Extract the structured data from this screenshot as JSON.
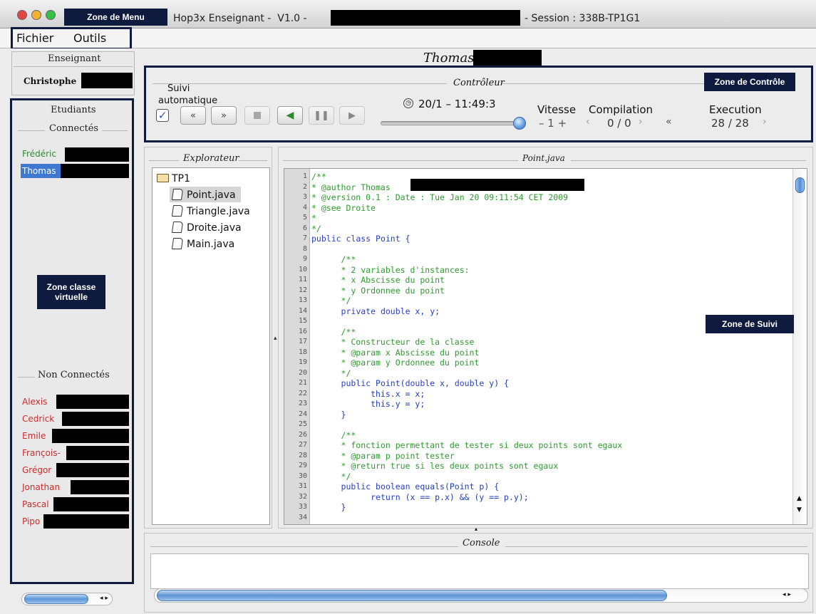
{
  "window": {
    "title_app": "Hop3x Enseignant -  V1.0 -",
    "title_session": "- Session : 338B-TP1G1"
  },
  "annotations": {
    "menu_zone": "Zone de Menu",
    "control_zone": "Zone de Contrôle",
    "class_zone_line1": "Zone classe",
    "class_zone_line2": "virtuelle",
    "tracking_zone": "Zone de Suivi"
  },
  "menu": {
    "items": [
      "Fichier",
      "Outils"
    ]
  },
  "teacher": {
    "group_title": "Enseignant",
    "name": "Christophe"
  },
  "students": {
    "group_title": "Etudiants",
    "connected_title": "Connectés",
    "connected": [
      "Frédéric",
      "Thomas"
    ],
    "disconnected_title": "Non Connectés",
    "disconnected": [
      "Alexis",
      "Cedrick",
      "Emile",
      "François-",
      "Grégor",
      "Jonathan",
      "Pascal",
      "Pipo"
    ]
  },
  "selected_student": "Thomas",
  "controller": {
    "title": "Contrôleur",
    "auto_follow_label_1": "Suivi",
    "auto_follow_label_2": "automatique",
    "auto_follow_checked": true,
    "timestamp": "20/1 – 11:49:3",
    "speed_label": "Vitesse",
    "speed_value": "– 1 +",
    "compilation_label": "Compilation",
    "compilation_value": "0 / 0",
    "execution_label": "Execution",
    "execution_value": "28 / 28",
    "slider_position": 0.97
  },
  "explorer": {
    "title": "Explorateur",
    "folder": "TP1",
    "files": [
      "Point.java",
      "Triangle.java",
      "Droite.java",
      "Main.java"
    ],
    "selected_file": "Point.java"
  },
  "editor": {
    "title": "Point.java",
    "lines": [
      {
        "n": "1",
        "t": "/**",
        "c": "comment"
      },
      {
        "n": "2",
        "t": "* @author Thomas",
        "c": "comment"
      },
      {
        "n": "3",
        "t": "* @version 0.1 : Date : Tue Jan 20 09:11:54 CET 2009",
        "c": "comment"
      },
      {
        "n": "4",
        "t": "* @see Droite",
        "c": "comment"
      },
      {
        "n": "5",
        "t": "*",
        "c": "comment"
      },
      {
        "n": "6",
        "t": "*/",
        "c": "comment"
      },
      {
        "n": "7",
        "t": "public class Point {",
        "c": "code"
      },
      {
        "n": "8",
        "t": "",
        "c": "code"
      },
      {
        "n": "9",
        "t": "      /**",
        "c": "comment"
      },
      {
        "n": "10",
        "t": "      * 2 variables d'instances:",
        "c": "comment"
      },
      {
        "n": "11",
        "t": "      * x Abscisse du point",
        "c": "comment"
      },
      {
        "n": "12",
        "t": "      * y Ordonnee du point",
        "c": "comment"
      },
      {
        "n": "13",
        "t": "      */",
        "c": "comment"
      },
      {
        "n": "14",
        "t": "      private double x, y;",
        "c": "code"
      },
      {
        "n": "15",
        "t": "",
        "c": "code"
      },
      {
        "n": "16",
        "t": "      /**",
        "c": "comment"
      },
      {
        "n": "17",
        "t": "      * Constructeur de la classe",
        "c": "comment"
      },
      {
        "n": "18",
        "t": "      * @param x Abscisse du point",
        "c": "comment"
      },
      {
        "n": "19",
        "t": "      * @param y Ordonnee du point",
        "c": "comment"
      },
      {
        "n": "20",
        "t": "      */",
        "c": "comment"
      },
      {
        "n": "21",
        "t": "      public Point(double x, double y) {",
        "c": "code"
      },
      {
        "n": "22",
        "t": "            this.x = x;",
        "c": "code"
      },
      {
        "n": "23",
        "t": "            this.y = y;",
        "c": "code"
      },
      {
        "n": "24",
        "t": "      }",
        "c": "code"
      },
      {
        "n": "25",
        "t": "",
        "c": "code"
      },
      {
        "n": "26",
        "t": "      /**",
        "c": "comment"
      },
      {
        "n": "27",
        "t": "      * fonction permettant de tester si deux points sont egaux",
        "c": "comment"
      },
      {
        "n": "28",
        "t": "      * @param p point tester",
        "c": "comment"
      },
      {
        "n": "29",
        "t": "      * @return true si les deux points sont egaux",
        "c": "comment"
      },
      {
        "n": "30",
        "t": "      */",
        "c": "comment"
      },
      {
        "n": "31",
        "t": "      public boolean equals(Point p) {",
        "c": "code"
      },
      {
        "n": "32",
        "t": "            return (x == p.x) && (y == p.y);",
        "c": "code"
      },
      {
        "n": "33",
        "t": "      }",
        "c": "code"
      },
      {
        "n": "34",
        "t": "",
        "c": "code"
      }
    ]
  },
  "console": {
    "title": "Console"
  },
  "colors": {
    "annotation_navy": "#0e1b3e",
    "comment": "#2f9a2f",
    "keyword": "#2a3fcc",
    "connected": "#2f8a2f",
    "disconnected": "#cc2c2c",
    "selection": "#3f78cf"
  }
}
